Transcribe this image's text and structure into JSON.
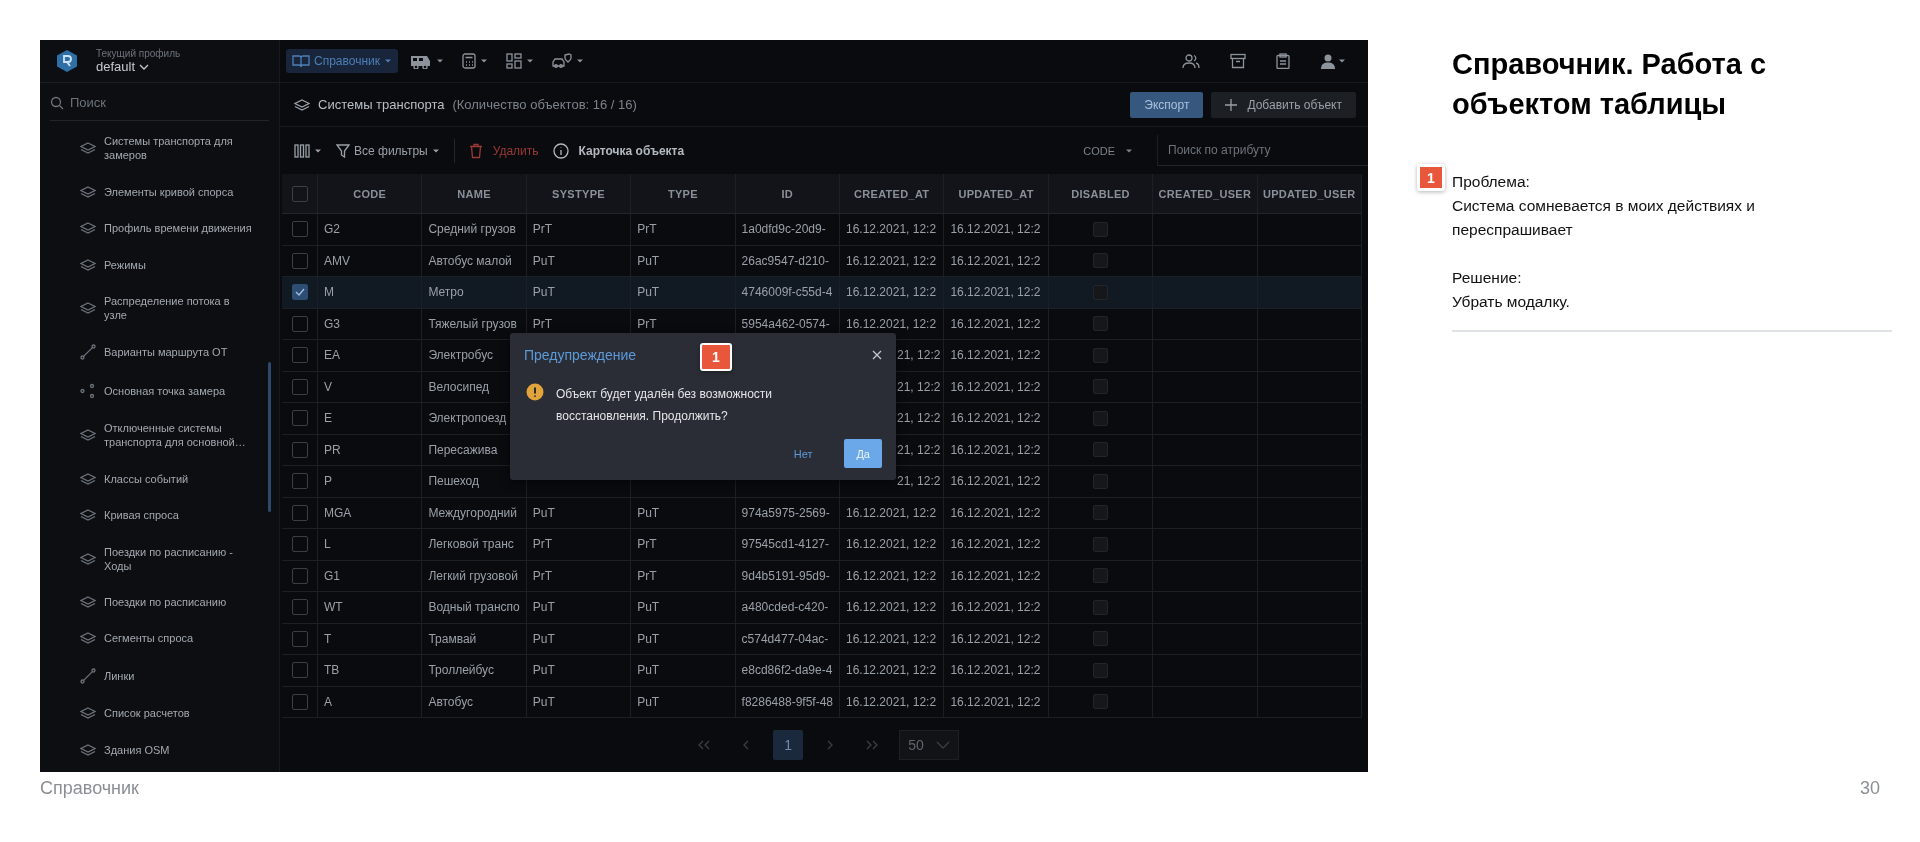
{
  "profile": {
    "label": "Текущий профиль",
    "value": "default"
  },
  "sidebar": {
    "search_placeholder": "Поиск",
    "items": [
      {
        "label": "Системы транспорта для замеров",
        "kind": "layers"
      },
      {
        "label": "Элементы кривой спорса",
        "kind": "layers"
      },
      {
        "label": "Профиль времени движения",
        "kind": "layers"
      },
      {
        "label": "Режимы",
        "kind": "layers"
      },
      {
        "label": "Распределение потока в узле",
        "kind": "layers"
      },
      {
        "label": "Варианты маршрута ОТ",
        "kind": "route"
      },
      {
        "label": "Основная точка замера",
        "kind": "points"
      },
      {
        "label": "Отключенные системы транспорта для основной…",
        "kind": "layers"
      },
      {
        "label": "Классы событий",
        "kind": "layers"
      },
      {
        "label": "Кривая спроса",
        "kind": "layers"
      },
      {
        "label": "Поездки по расписанию - Ходы",
        "kind": "layers"
      },
      {
        "label": "Поездки по расписанию",
        "kind": "layers"
      },
      {
        "label": "Сегменты спроса",
        "kind": "layers"
      },
      {
        "label": "Линки",
        "kind": "route"
      },
      {
        "label": "Список расчетов",
        "kind": "layers"
      },
      {
        "label": "Здания OSM",
        "kind": "layers"
      }
    ]
  },
  "topbar": {
    "menus": [
      {
        "kind": "book",
        "label": "Справочник",
        "selected": true
      },
      {
        "kind": "bus",
        "selected": false
      },
      {
        "kind": "calculator",
        "selected": false
      },
      {
        "kind": "grid",
        "selected": false
      },
      {
        "kind": "car",
        "selected": false
      }
    ],
    "actions": [
      {
        "kind": "users"
      },
      {
        "kind": "archive"
      },
      {
        "kind": "clipboard"
      },
      {
        "kind": "user"
      }
    ]
  },
  "header": {
    "title": "Системы транспорта",
    "count": "(Количество объектов: 16 / 16)",
    "buttons": [
      {
        "label": "Экспорт",
        "kind": "primary"
      },
      {
        "label": "Добавить объект",
        "kind": "add"
      }
    ]
  },
  "toolbar": {
    "filters": "Все фильтры",
    "delete": "Удалить",
    "card": "Карточка объекта",
    "attribute": "CODE",
    "search_placeholder": "Поиск по атрибуту"
  },
  "table": {
    "select_all": false,
    "columns": [
      "CODE",
      "NAME",
      "SYSTYPE",
      "TYPE",
      "ID",
      "CREATED_AT",
      "UPDATED_AT",
      "DISABLED",
      "CREATED_USER",
      "UPDATED_USER"
    ],
    "rows": [
      {
        "selected": false,
        "disabled": false,
        "cells": [
          "G2",
          "Средний грузов",
          "PrT",
          "PrT",
          "1a0dfd9c-20d9-",
          "16.12.2021, 12:2",
          "16.12.2021, 12:2"
        ]
      },
      {
        "selected": false,
        "disabled": false,
        "cells": [
          "AMV",
          "Автобус малой",
          "PuT",
          "PuT",
          "26ac9547-d210-",
          "16.12.2021, 12:2",
          "16.12.2021, 12:2"
        ]
      },
      {
        "selected": true,
        "disabled": false,
        "cells": [
          "M",
          "Метро",
          "PuT",
          "PuT",
          "4746009f-c55d-4",
          "16.12.2021, 12:2",
          "16.12.2021, 12:2"
        ]
      },
      {
        "selected": false,
        "disabled": false,
        "cells": [
          "G3",
          "Тяжелый грузов",
          "PrT",
          "PrT",
          "5954a462-0574-",
          "16.12.2021, 12:2",
          "16.12.2021, 12:2"
        ]
      },
      {
        "selected": false,
        "disabled": false,
        "cells": [
          "EA",
          "Электробус",
          null,
          null,
          null,
          "21, 12:2",
          "16.12.2021, 12:2"
        ]
      },
      {
        "selected": false,
        "disabled": false,
        "cells": [
          "V",
          "Велосипед",
          null,
          null,
          null,
          "21, 12:2",
          "16.12.2021, 12:2"
        ]
      },
      {
        "selected": false,
        "disabled": false,
        "cells": [
          "E",
          "Электропоезд",
          null,
          null,
          null,
          "21, 12:2",
          "16.12.2021, 12:2"
        ]
      },
      {
        "selected": false,
        "disabled": false,
        "cells": [
          "PR",
          "Пересажива",
          null,
          null,
          null,
          "21, 12:2",
          "16.12.2021, 12:2"
        ]
      },
      {
        "selected": false,
        "disabled": false,
        "cells": [
          "P",
          "Пешеход",
          null,
          null,
          null,
          "21, 12:2",
          "16.12.2021, 12:2"
        ]
      },
      {
        "selected": false,
        "disabled": false,
        "cells": [
          "MGA",
          "Междугородний",
          "PuT",
          "PuT",
          "974a5975-2569-",
          "16.12.2021, 12:2",
          "16.12.2021, 12:2"
        ]
      },
      {
        "selected": false,
        "disabled": false,
        "cells": [
          "L",
          "Легковой транс",
          "PrT",
          "PrT",
          "97545cd1-4127-",
          "16.12.2021, 12:2",
          "16.12.2021, 12:2"
        ]
      },
      {
        "selected": false,
        "disabled": false,
        "cells": [
          "G1",
          "Легкий грузовой",
          "PrT",
          "PrT",
          "9d4b5191-95d9-",
          "16.12.2021, 12:2",
          "16.12.2021, 12:2"
        ]
      },
      {
        "selected": false,
        "disabled": false,
        "cells": [
          "WT",
          "Водный транспо",
          "PuT",
          "PuT",
          "a480cded-c420-",
          "16.12.2021, 12:2",
          "16.12.2021, 12:2"
        ]
      },
      {
        "selected": false,
        "disabled": false,
        "cells": [
          "T",
          "Трамвай",
          "PuT",
          "PuT",
          "c574d477-04ac-",
          "16.12.2021, 12:2",
          "16.12.2021, 12:2"
        ]
      },
      {
        "selected": false,
        "disabled": false,
        "cells": [
          "TB",
          "Троллейбус",
          "PuT",
          "PuT",
          "e8cd86f2-da9e-4",
          "16.12.2021, 12:2",
          "16.12.2021, 12:2"
        ]
      },
      {
        "selected": false,
        "disabled": false,
        "cells": [
          "A",
          "Автобус",
          "PuT",
          "PuT",
          "f8286488-9f5f-48",
          "16.12.2021, 12:2",
          "16.12.2021, 12:2"
        ]
      }
    ]
  },
  "pagination": {
    "pages": [
      {
        "label": "1",
        "selected": true
      }
    ],
    "page_size": "50"
  },
  "dialog": {
    "title": "Предупреждение",
    "message": "Объект будет удалён без возможности восстановления. Продолжить?",
    "buttons": [
      {
        "label": "Нет",
        "kind": "secondary"
      },
      {
        "label": "Да",
        "kind": "primary"
      }
    ]
  },
  "annotation": {
    "number": "1"
  },
  "notes": {
    "title": "Справочник. Работа с объектом таблицы",
    "badge": "1",
    "problem_label": "Проблема:",
    "problem": "Система сомневается в моих действиях и переспрашивает",
    "solution_label": "Решение:",
    "solution": "Убрать модалку."
  },
  "footer": {
    "section": "Справочник",
    "page": "30"
  }
}
